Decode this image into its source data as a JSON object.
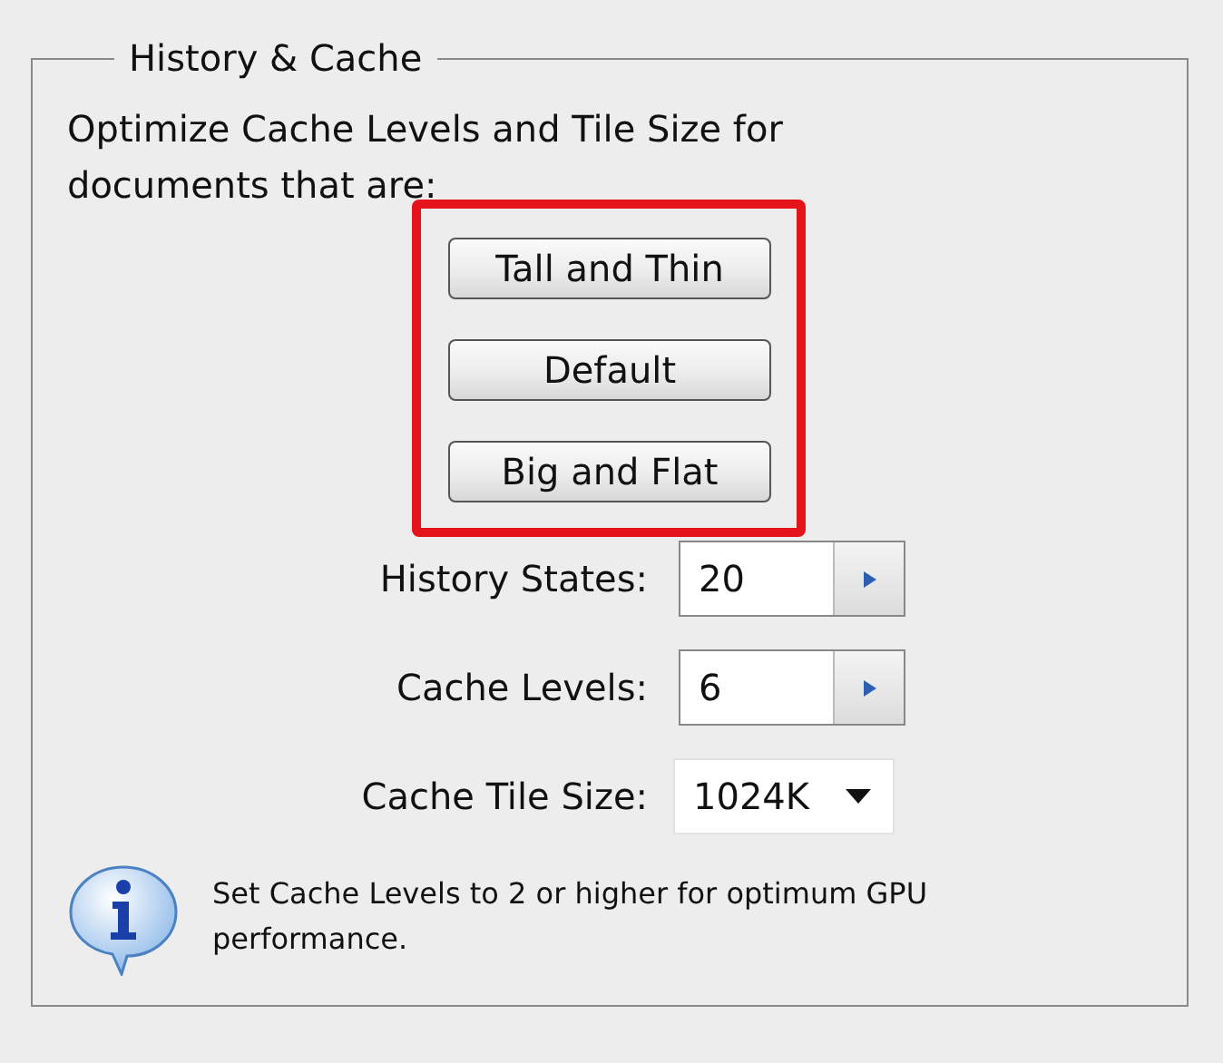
{
  "group": {
    "title": "History & Cache"
  },
  "intro": "Optimize Cache Levels and Tile Size for documents that are:",
  "presets": [
    {
      "label": "Tall and Thin"
    },
    {
      "label": "Default"
    },
    {
      "label": "Big and Flat"
    }
  ],
  "fields": [
    {
      "kind": "spinner",
      "label": "History States:",
      "value": "20"
    },
    {
      "kind": "spinner",
      "label": "Cache Levels:",
      "value": "6"
    },
    {
      "kind": "dropdown",
      "label": "Cache Tile Size:",
      "value": "1024K"
    }
  ],
  "note": "Set Cache Levels to 2 or higher for optimum GPU performance."
}
